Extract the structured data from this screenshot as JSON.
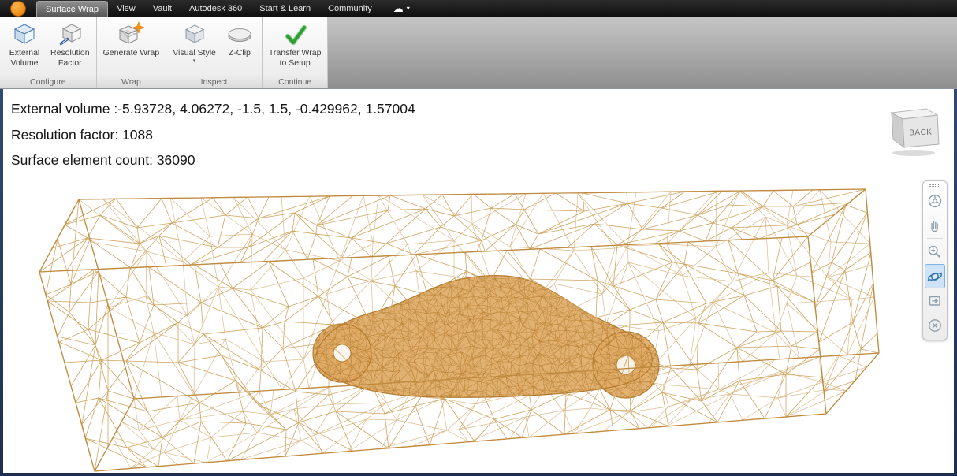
{
  "menubar": {
    "tabs": [
      {
        "label": "Surface Wrap"
      },
      {
        "label": "View"
      },
      {
        "label": "Vault"
      },
      {
        "label": "Autodesk 360"
      },
      {
        "label": "Start & Learn"
      },
      {
        "label": "Community"
      }
    ]
  },
  "ribbon": {
    "groups": [
      {
        "name": "Configure",
        "buttons": [
          {
            "line1": "External",
            "line2": "Volume"
          },
          {
            "line1": "Resolution",
            "line2": "Factor"
          }
        ]
      },
      {
        "name": "Wrap",
        "buttons": [
          {
            "line1": "Generate Wrap",
            "line2": ""
          }
        ]
      },
      {
        "name": "Inspect",
        "buttons": [
          {
            "line1": "Visual Style",
            "line2": ""
          },
          {
            "line1": "Z-Clip",
            "line2": ""
          }
        ]
      },
      {
        "name": "Continue",
        "buttons": [
          {
            "line1": "Transfer Wrap",
            "line2": "to Setup"
          }
        ]
      }
    ]
  },
  "viewport": {
    "readout": [
      "External volume :-5.93728, 4.06272, -1.5, 1.5, -0.429962, 1.57004",
      "Resolution factor: 1088",
      "Surface element count: 36090"
    ],
    "viewcube_label": "BACK"
  },
  "icons": {
    "cloud": "☁",
    "caret": "▾"
  },
  "colors": {
    "mesh": "#cfa05a",
    "mesh_edge": "#c08b3f",
    "car_fill": "#e0ab66",
    "car_mesh": "#b47a2c",
    "nav_active_bg": "#cfe3f6",
    "check_green": "#2e9e33",
    "star_orange": "#f7941e"
  }
}
